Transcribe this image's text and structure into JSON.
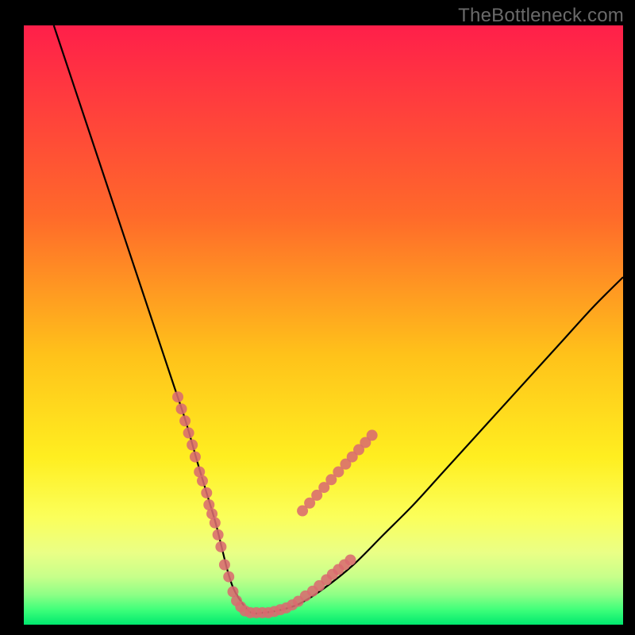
{
  "watermark": "TheBottleneck.com",
  "chart_data": {
    "type": "line",
    "title": "",
    "xlabel": "",
    "ylabel": "",
    "xlim": [
      0,
      100
    ],
    "ylim": [
      0,
      100
    ],
    "grid": false,
    "series": [
      {
        "name": "bottleneck-curve",
        "x": [
          5,
          8,
          11,
          14,
          17,
          20,
          23,
          25,
          27,
          29,
          30.5,
          32,
          33,
          34,
          35,
          36.5,
          38,
          40,
          43,
          46,
          50,
          55,
          60,
          65,
          70,
          75,
          80,
          85,
          90,
          95,
          100
        ],
        "y": [
          100,
          91,
          82,
          73,
          64,
          55,
          46,
          40,
          34,
          27,
          22,
          17,
          13,
          9,
          6,
          3.5,
          2,
          2,
          2.5,
          3.5,
          6,
          10,
          15,
          20,
          25.5,
          31,
          36.5,
          42,
          47.5,
          53,
          58
        ]
      }
    ],
    "marker_clusters": [
      {
        "name": "left-cluster",
        "x": [
          25.7,
          26.3,
          26.9,
          27.5,
          28.1,
          28.6,
          29.3,
          29.8,
          30.5,
          30.9,
          31.4,
          31.9,
          32.4,
          32.9
        ],
        "y": [
          38,
          36,
          34,
          32,
          30,
          28,
          25.5,
          24,
          22,
          20,
          18.5,
          17,
          15,
          13
        ]
      },
      {
        "name": "bottom-cluster",
        "x": [
          33.5,
          34.2,
          34.9,
          35.5,
          36.2,
          36.9,
          37.8,
          38.8,
          39.8,
          40.8,
          41.8,
          42.8,
          43.8
        ],
        "y": [
          10,
          8,
          5.5,
          4,
          3,
          2.3,
          2,
          2,
          2,
          2,
          2.2,
          2.5,
          2.8
        ]
      },
      {
        "name": "right-cluster",
        "x": [
          44.8,
          45.8,
          47,
          48.2,
          49.3,
          50.5,
          51.5,
          52.5,
          53.5,
          54.5
        ],
        "y": [
          3.3,
          3.9,
          4.8,
          5.6,
          6.5,
          7.5,
          8.4,
          9.2,
          10,
          10.8
        ]
      },
      {
        "name": "right-upper-cluster",
        "x": [
          46.5,
          47.7,
          48.9,
          50.1,
          51.3,
          52.5,
          53.7,
          54.8,
          55.9,
          57.0,
          58.1
        ],
        "y": [
          19,
          20.3,
          21.6,
          22.9,
          24.2,
          25.5,
          26.8,
          28,
          29.2,
          30.4,
          31.6
        ]
      }
    ],
    "gradient_stops": [
      {
        "offset": 0,
        "color": "#ff1f4a"
      },
      {
        "offset": 32,
        "color": "#ff6a2a"
      },
      {
        "offset": 55,
        "color": "#ffc21a"
      },
      {
        "offset": 72,
        "color": "#ffee20"
      },
      {
        "offset": 82,
        "color": "#fbff5a"
      },
      {
        "offset": 88,
        "color": "#eaff86"
      },
      {
        "offset": 92,
        "color": "#c7ff8a"
      },
      {
        "offset": 95,
        "color": "#8dff86"
      },
      {
        "offset": 97.5,
        "color": "#3fff7a"
      },
      {
        "offset": 100,
        "color": "#00e86e"
      }
    ],
    "colors": {
      "curve": "#000000",
      "markers": "#d96b6f",
      "background_frame": "#000000"
    }
  }
}
